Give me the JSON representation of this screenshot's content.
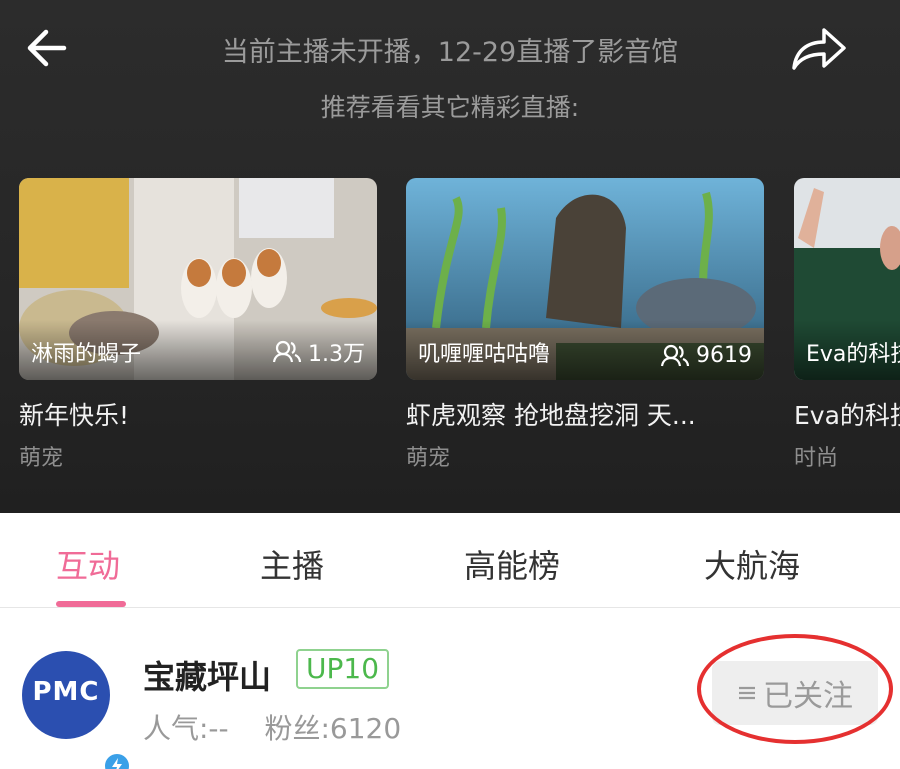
{
  "header": {
    "notice": "当前主播未开播，12-29直播了影音馆",
    "sub_notice": "推荐看看其它精彩直播:",
    "back_icon": "arrow-left-icon",
    "share_icon": "share-icon"
  },
  "recommendations": [
    {
      "anchor": "淋雨的蝎子",
      "viewers": "1.3万",
      "title": "新年快乐!",
      "category": "萌宠"
    },
    {
      "anchor": "叽喱喱咕咕噜",
      "viewers": "9619",
      "title": "虾虎观察 抢地盘挖洞 天...",
      "category": "萌宠"
    },
    {
      "anchor": "Eva的科技",
      "viewers": "",
      "title": "Eva的科技",
      "category": "时尚"
    }
  ],
  "tabs": [
    {
      "label": "互动",
      "active": true
    },
    {
      "label": "主播",
      "active": false
    },
    {
      "label": "高能榜",
      "active": false
    },
    {
      "label": "大航海",
      "active": false
    }
  ],
  "profile": {
    "avatar_text": "PMC",
    "name": "宝藏坪山",
    "level": "UP10",
    "popularity": "人气:--",
    "fans": "粉丝:6120",
    "follow_label": "已关注",
    "follow_icon": "menu-lines-icon"
  },
  "colors": {
    "accent": "#f06b97",
    "level_green": "#4cb84c",
    "highlight": "#e53030"
  }
}
